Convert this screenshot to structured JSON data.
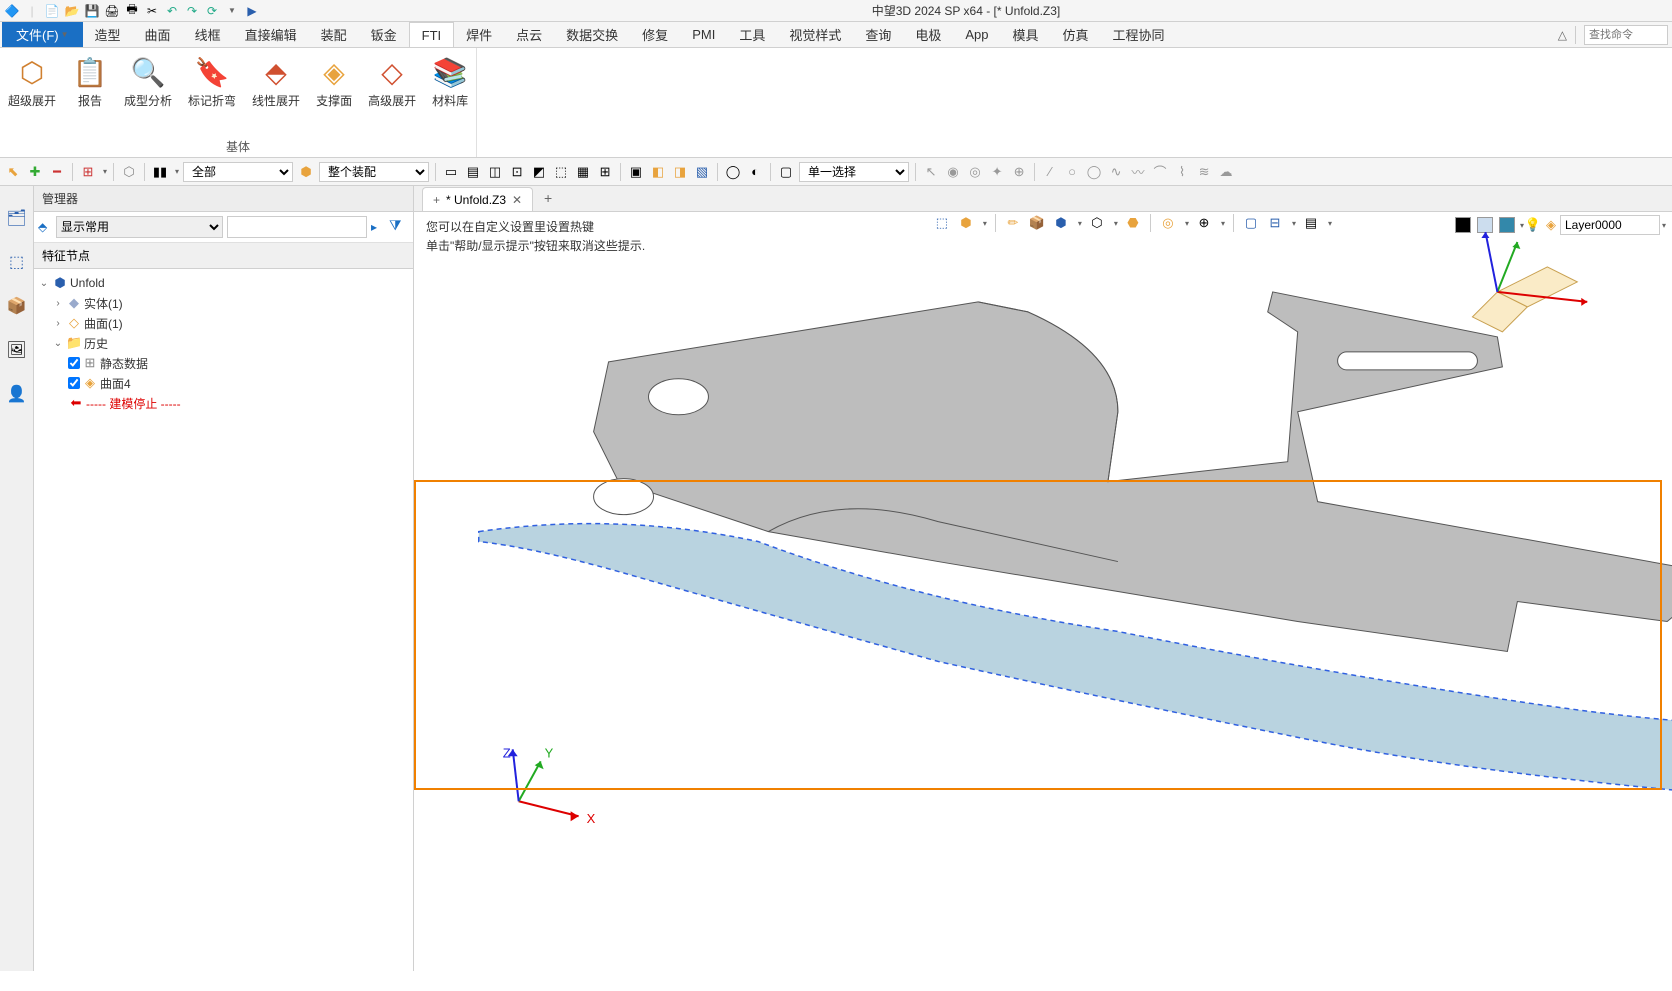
{
  "app": {
    "title": "中望3D 2024 SP x64 - [* Unfold.Z3]"
  },
  "qat": [
    "zw3d",
    "new",
    "open",
    "save",
    "print",
    "print2",
    "cut",
    "undo",
    "redo",
    "play"
  ],
  "menu": {
    "file": "文件(F)",
    "items": [
      "造型",
      "曲面",
      "线框",
      "直接编辑",
      "装配",
      "钣金",
      "FTI",
      "焊件",
      "点云",
      "数据交换",
      "修复",
      "PMI",
      "工具",
      "视觉样式",
      "查询",
      "电极",
      "App",
      "模具",
      "仿真",
      "工程协同"
    ],
    "active": "FTI",
    "search_placeholder": "查找命令",
    "help_icon": "^"
  },
  "ribbon": {
    "buttons": [
      {
        "label": "超级展开"
      },
      {
        "label": "报告"
      },
      {
        "label": "成型分析"
      },
      {
        "label": "标记折弯"
      },
      {
        "label": "线性展开"
      },
      {
        "label": "支撑面"
      },
      {
        "label": "高级展开"
      },
      {
        "label": "材料库"
      }
    ],
    "group_label": "基体"
  },
  "toolbar2": {
    "select_all": "全部",
    "select_assembly": "整个装配",
    "select_mode": "单一选择"
  },
  "manager": {
    "title": "管理器",
    "filter_select": "显示常用",
    "header": "特征节点",
    "tree": {
      "root": "Unfold",
      "solid": "实体(1)",
      "surface": "曲面(1)",
      "history": "历史",
      "static_data": "静态数据",
      "surface4": "曲面4",
      "model_stop": "----- 建模停止 -----"
    }
  },
  "doc_tab": {
    "name": "* Unfold.Z3"
  },
  "hints": {
    "line1": "您可以在自定义设置里设置热键",
    "line2": "单击\"帮助/显示提示\"按钮来取消这些提示."
  },
  "layer": {
    "name": "Layer0000"
  },
  "axes": {
    "x": "X",
    "y": "Y",
    "z": "Z"
  }
}
